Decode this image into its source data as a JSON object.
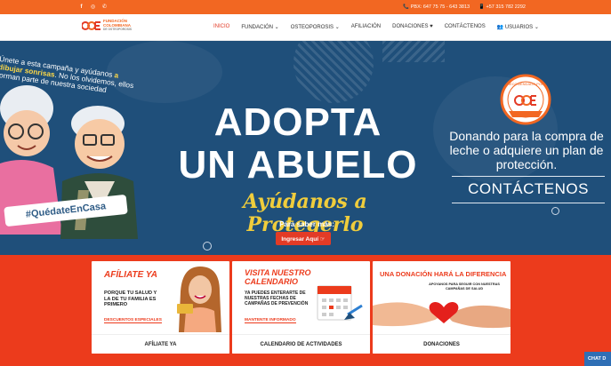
{
  "topbar": {
    "social": [
      "f",
      "◎",
      "✆"
    ],
    "pbx": "📞 PBX: 647 75 75 - 643 3813",
    "cell": "📱 +57 315 782 2292"
  },
  "logo": {
    "line1": "FUNDACIÓN",
    "line2": "COLOMBIANA",
    "line3": "DE OSTEOPOROSIS"
  },
  "menu": [
    "INICIO",
    "FUNDACIÓN ⌄",
    "OSTEOPOROSIS ⌄",
    "AFILIACIÓN",
    "DONACIONES ♥",
    "CONTÁCTENOS",
    "👥 USUARIOS ⌄"
  ],
  "hero": {
    "side_text_1": "Únete a esta campaña y ayúdanos",
    "side_text_2": "a dibujar sonrisas",
    "side_text_3": ". No los olvidemos,",
    "side_text_4": "ellos forman parte de nuestra sociedad",
    "hashtag": "#QuédateEnCasa",
    "headline_1": "ADOPTA",
    "headline_2": "UN ABUELO",
    "tagline": "Ayúdanos a Protegerlo",
    "saber": "Para saber más:",
    "button": "Ingresar Aquí ☞",
    "seal_top": "RECOMENDADO POR",
    "seal_bottom": "FUNDACIÓN COLOMBIANA DE OSTEOPOROSIS",
    "donando": "Donando para la compra de leche o adquiere un plan de protección.",
    "contact": "CONTÁCTENOS"
  },
  "cards": [
    {
      "title": "AFÍLIATE YA",
      "body": "PORQUE TU SALUD Y LA DE TU FAMILIA ES PRIMERO",
      "highlight": "DESCUENTOS ESPECIALES",
      "footer": "AFÍLIATE YA"
    },
    {
      "title": "VISITA NUESTRO CALENDARIO",
      "body": "YA PUEDES ENTERARTE DE NUESTRAS FECHAS DE CAMPAÑAS DE PREVENCIÓN",
      "highlight": "MANTENTE INFORMADO",
      "footer": "CALENDARIO DE ACTIVIDADES"
    },
    {
      "title": "UNA DONACIÓN HARÁ LA DIFERENCIA",
      "body": "APOYANOS PARA SEGUIR CON NUESTRAS CAMPAÑAS DE SALUD",
      "footer": "DONACIONES"
    }
  ],
  "chat": "CHAT D",
  "colors": {
    "brand_orange": "#f26722",
    "hero_blue": "#1f4f7a",
    "accent_red": "#ec3b1c",
    "yellow": "#f0cd3c"
  }
}
